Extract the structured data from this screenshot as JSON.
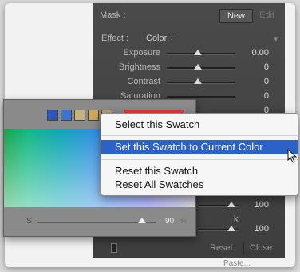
{
  "panel": {
    "mask_label": "Mask :",
    "mask_new": "New",
    "mask_edit": "Edit",
    "effect_label": "Effect :",
    "effect_value": "Color ÷",
    "sliders": [
      {
        "label": "Exposure",
        "value": "0.00"
      },
      {
        "label": "Brightness",
        "value": "0"
      },
      {
        "label": "Contrast",
        "value": "0"
      },
      {
        "label": "Saturation",
        "value": "0"
      }
    ],
    "lower_rows": [
      {
        "label": "",
        "value": "100"
      },
      {
        "label": "k",
        "value": "100"
      }
    ],
    "reset_button": "Reset",
    "close_button": "Close",
    "footer_text": "Paste..."
  },
  "picker": {
    "swatch_colors": [
      "#2f55b7",
      "#3b74d1",
      "#c6b37a",
      "#cda85d",
      "#b3a17a"
    ],
    "saturation_label": "S",
    "saturation_value": "90",
    "saturation_unit": "%",
    "saturation_level": 0.9
  },
  "context_menu": {
    "items": [
      "Select this Swatch",
      "Set this Swatch to Current Color",
      "Reset this Swatch",
      "Reset All Swatches"
    ],
    "selected_index": 1
  }
}
